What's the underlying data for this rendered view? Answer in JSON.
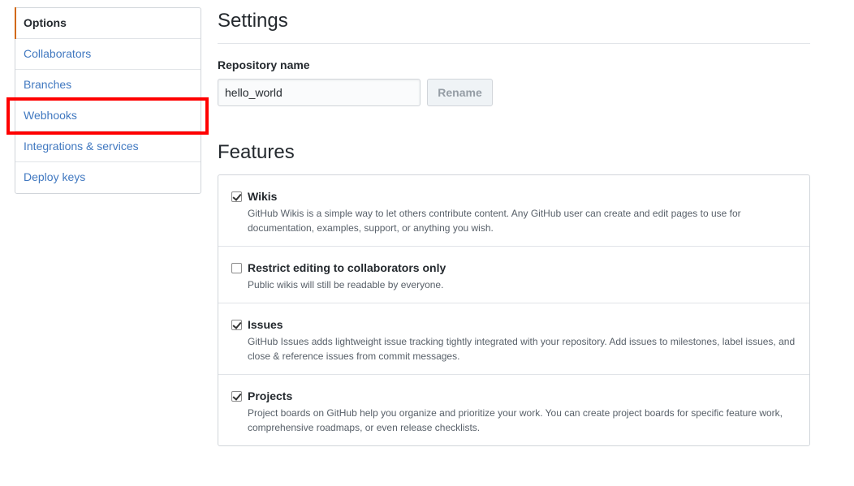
{
  "sidebar": {
    "items": [
      {
        "label": "Options",
        "selected": true
      },
      {
        "label": "Collaborators",
        "selected": false
      },
      {
        "label": "Branches",
        "selected": false
      },
      {
        "label": "Webhooks",
        "selected": false
      },
      {
        "label": "Integrations & services",
        "selected": false
      },
      {
        "label": "Deploy keys",
        "selected": false
      }
    ]
  },
  "settings": {
    "title": "Settings",
    "repo_label": "Repository name",
    "repo_value": "hello_world",
    "rename_label": "Rename"
  },
  "features": {
    "title": "Features",
    "items": [
      {
        "name": "Wikis",
        "checked": true,
        "description": "GitHub Wikis is a simple way to let others contribute content. Any GitHub user can create and edit pages to use for documentation, examples, support, or anything you wish."
      },
      {
        "name": "Restrict editing to collaborators only",
        "checked": false,
        "description": "Public wikis will still be readable by everyone."
      },
      {
        "name": "Issues",
        "checked": true,
        "description": "GitHub Issues adds lightweight issue tracking tightly integrated with your repository. Add issues to milestones, label issues, and close & reference issues from commit messages."
      },
      {
        "name": "Projects",
        "checked": true,
        "description": "Project boards on GitHub help you organize and prioritize your work. You can create project boards for specific feature work, comprehensive roadmaps, or even release checklists."
      }
    ]
  },
  "colors": {
    "link": "#4078c0",
    "selected_accent": "#d26911",
    "highlight": "#ff0000"
  }
}
